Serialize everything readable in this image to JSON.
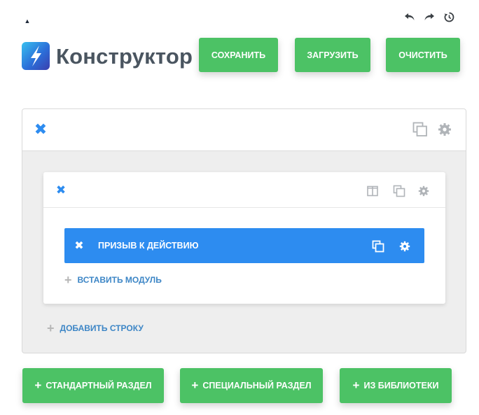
{
  "app": {
    "title": "Конструктор"
  },
  "colors": {
    "accent_green": "#4cc265",
    "accent_blue": "#2d8cf0",
    "link_blue": "#3d86c6",
    "title_gray": "#4a5560"
  },
  "icons": {
    "collapse": "triangle-up-icon",
    "undo": "undo-icon",
    "redo": "redo-icon",
    "history": "history-icon",
    "logo": "lightning-bolt-icon",
    "close": "close-icon",
    "duplicate": "duplicate-icon",
    "settings": "gear-icon",
    "columns": "columns-icon",
    "add": "plus-icon"
  },
  "toolbar": {
    "save_label": "СОХРАНИТЬ",
    "load_label": "ЗАГРУЗИТЬ",
    "clear_label": "ОЧИСТИТЬ"
  },
  "section": {
    "row": {
      "module": {
        "label": "ПРИЗЫВ К ДЕЙСТВИЮ"
      },
      "insert_module_label": "ВСТАВИТЬ МОДУЛЬ"
    },
    "add_row_label": "ДОБАВИТЬ СТРОКУ"
  },
  "bottom_buttons": {
    "standard_label": "СТАНДАРТНЫЙ РАЗДЕЛ",
    "special_label": "СПЕЦИАЛЬНЫЙ РАЗДЕЛ",
    "library_label": "ИЗ БИБЛИОТЕКИ"
  }
}
